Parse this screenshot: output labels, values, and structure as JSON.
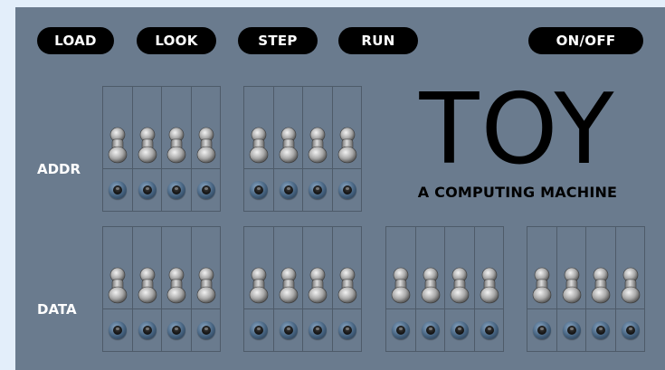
{
  "controls": {
    "load": "LOAD",
    "look": "LOOK",
    "step": "STEP",
    "run": "RUN",
    "onoff": "ON/OFF"
  },
  "labels": {
    "addr": "ADDR",
    "data": "DATA"
  },
  "brand": {
    "title": "TOY",
    "subtitle": "A COMPUTING MACHINE"
  },
  "icons": {
    "switch": "toggle-switch-icon",
    "light": "indicator-light-icon"
  },
  "colors": {
    "panel": "#6a7b8e",
    "page_background": "#e3eefa",
    "button": "#000000",
    "button_text": "#ffffff"
  }
}
